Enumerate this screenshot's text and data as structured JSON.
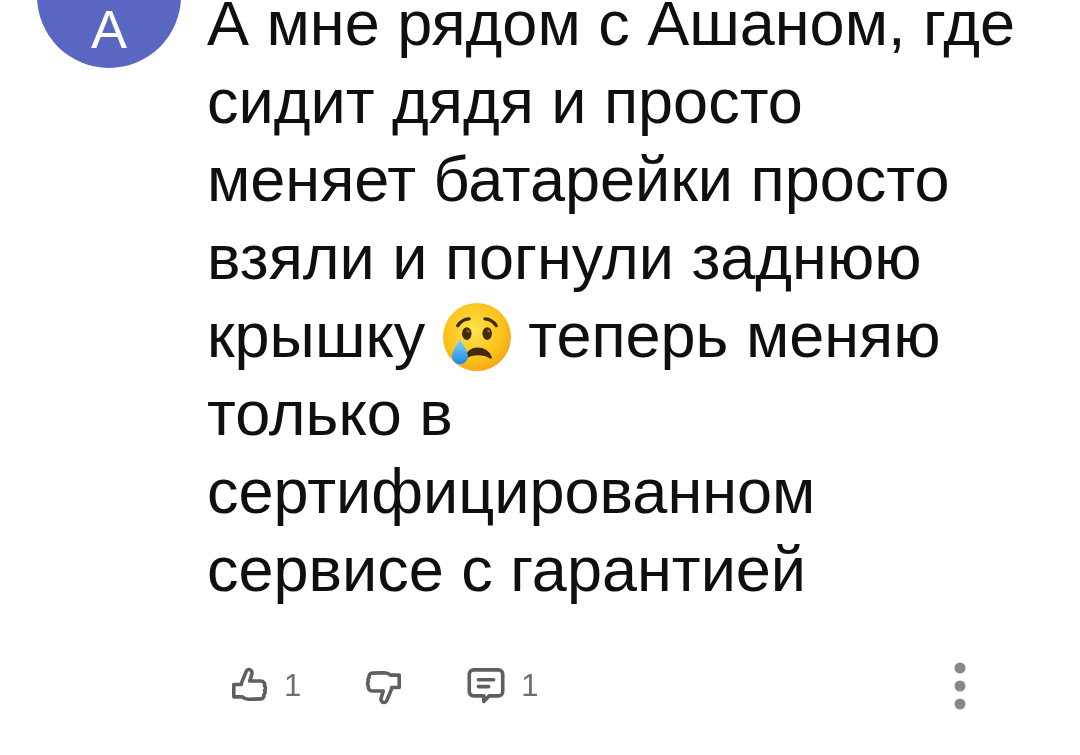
{
  "comment": {
    "avatar": {
      "letter": "А"
    },
    "body": [
      {
        "kind": "text",
        "text": "А мне рядом с Ашаном, где сидит дядя и просто меняет батарейки просто взяли и погнули заднюю крышку"
      },
      {
        "kind": "emoji"
      },
      {
        "kind": "text",
        "text": "теперь меняю только в сертифицированном сервисе с гарантией"
      }
    ],
    "actions": [
      {
        "kind": "like",
        "count": "1"
      },
      {
        "kind": "dislike"
      },
      {
        "kind": "reply",
        "count": "1"
      }
    ]
  }
}
